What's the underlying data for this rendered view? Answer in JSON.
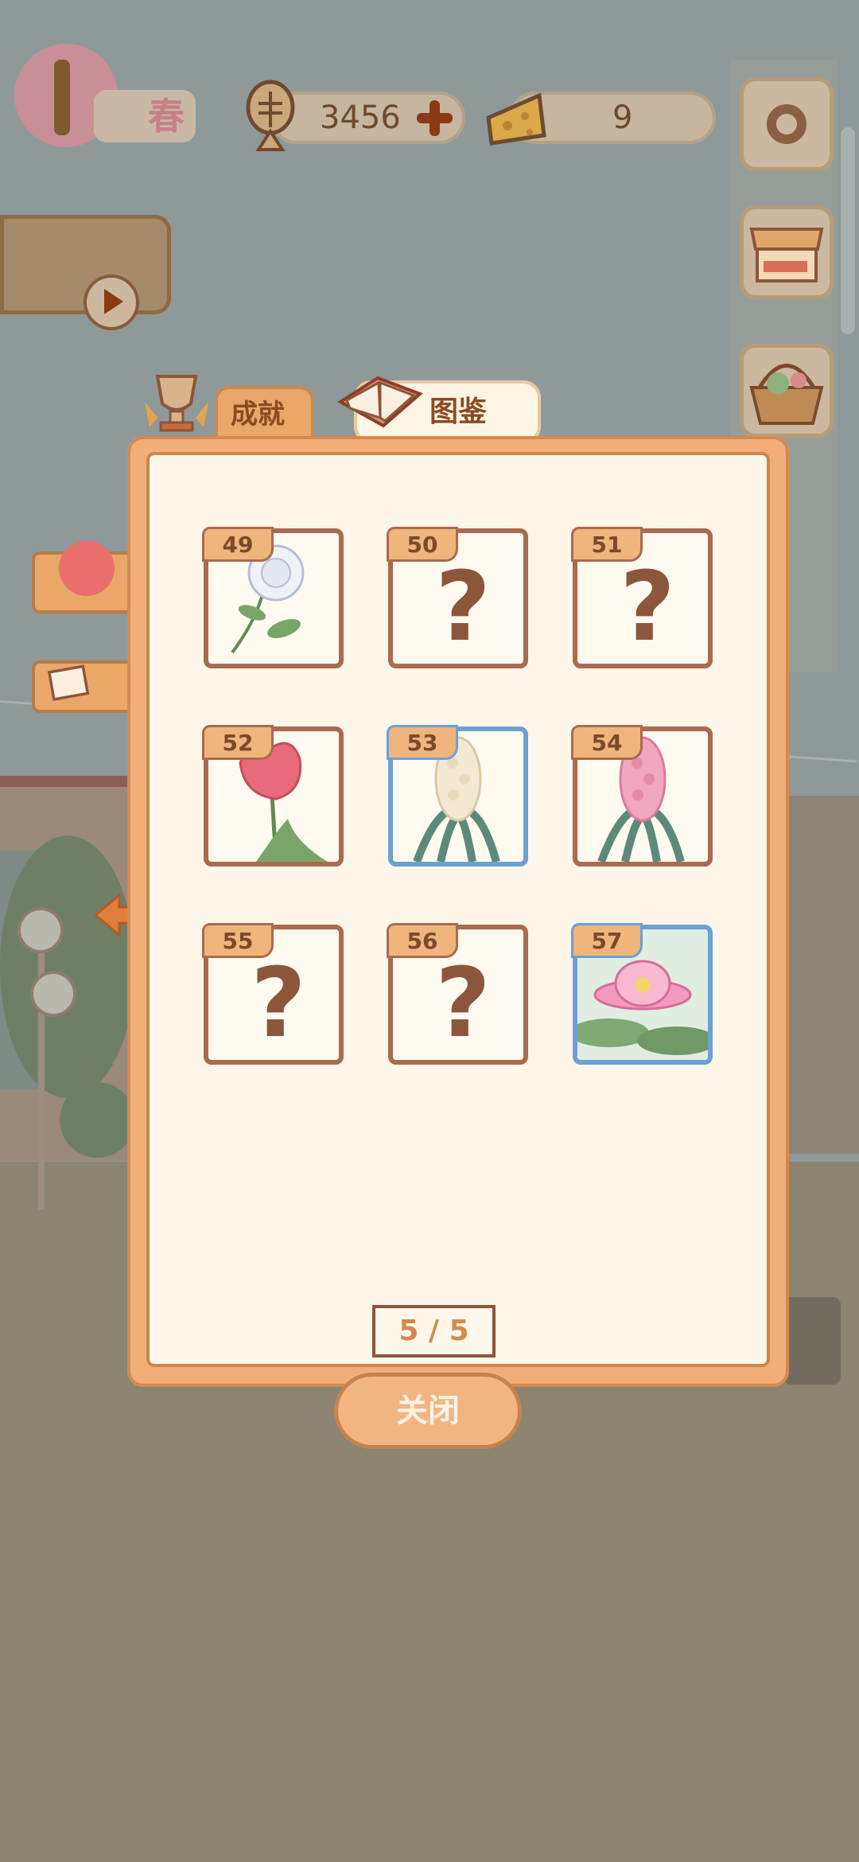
{
  "hud": {
    "season_label": "春",
    "fish_count": "3456",
    "cheese_count": "9"
  },
  "tabs": {
    "achievements_label": "成就",
    "catalog_label": "图鉴"
  },
  "catalog": {
    "cards": [
      {
        "number": "49",
        "discovered": true,
        "flower": "white-rose",
        "frame": "brown"
      },
      {
        "number": "50",
        "discovered": false,
        "placeholder": "?"
      },
      {
        "number": "51",
        "discovered": false,
        "placeholder": "?"
      },
      {
        "number": "52",
        "discovered": true,
        "flower": "pink-tulip",
        "frame": "brown"
      },
      {
        "number": "53",
        "discovered": true,
        "flower": "white-hyacinth",
        "frame": "blue"
      },
      {
        "number": "54",
        "discovered": true,
        "flower": "pink-hyacinth",
        "frame": "brown"
      },
      {
        "number": "55",
        "discovered": false,
        "placeholder": "?"
      },
      {
        "number": "56",
        "discovered": false,
        "placeholder": "?"
      },
      {
        "number": "57",
        "discovered": true,
        "flower": "water-lily",
        "frame": "blue"
      }
    ],
    "page_indicator": "5 / 5"
  },
  "dialog": {
    "close_label": "关闭"
  },
  "colors": {
    "panel_orange": "#f1ae78",
    "panel_cream": "#fef6e8",
    "frame_brown": "#a96b4f",
    "frame_blue": "#6ea0d2",
    "text_brown": "#7b4a2b"
  },
  "icons": [
    "fish-bone-icon",
    "plus-icon",
    "cheese-icon",
    "gear-icon",
    "shop-icon",
    "basket-icon",
    "trophy-icon",
    "book-icon",
    "rose-icon",
    "photo-icon",
    "arrow-left-icon",
    "play-icon"
  ]
}
